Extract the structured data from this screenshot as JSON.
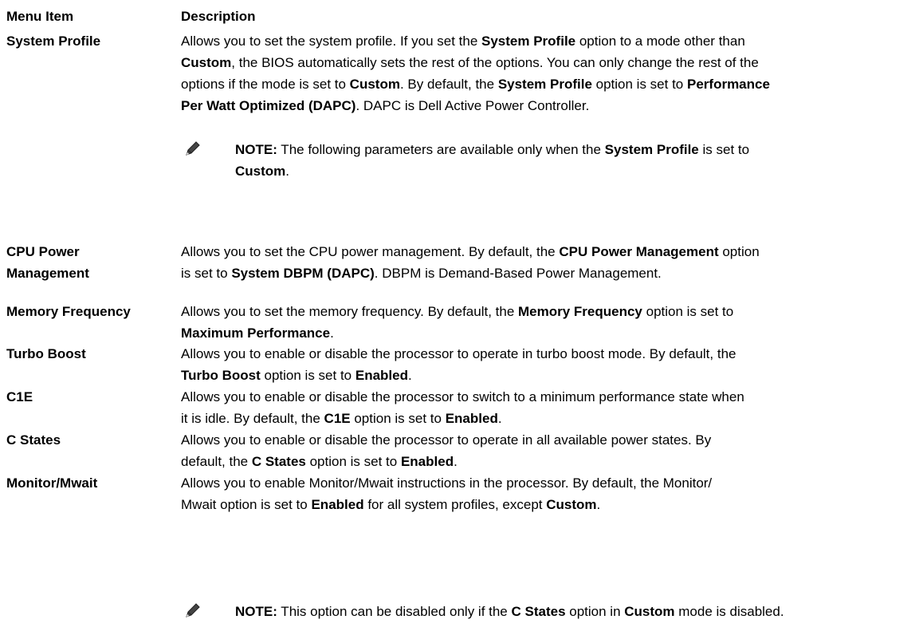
{
  "header": {
    "col1": "Menu Item",
    "col2": "Description"
  },
  "rows": [
    {
      "item": "System Profile",
      "desc": [
        [
          [
            "Allows you to set the system profile. If you set the ",
            false
          ],
          [
            "System Profile",
            true
          ],
          [
            " option to a mode other than",
            false
          ]
        ],
        [
          [
            "Custom",
            true
          ],
          [
            ", the BIOS automatically sets the rest of the options. You can only change the rest of the",
            false
          ]
        ],
        [
          [
            "options if the mode is set to ",
            false
          ],
          [
            "Custom",
            true
          ],
          [
            ". By default, the ",
            false
          ],
          [
            "System Profile",
            true
          ],
          [
            " option is set to ",
            false
          ],
          [
            "Performance",
            true
          ]
        ],
        [
          [
            "Per Watt Optimized (DAPC)",
            true
          ],
          [
            ". DAPC is Dell Active Power Controller.",
            false
          ]
        ]
      ],
      "note": [
        [
          [
            "NOTE:",
            true
          ],
          [
            " The following parameters are available only when the ",
            false
          ],
          [
            "System Profile",
            true
          ],
          [
            " is set to",
            false
          ]
        ],
        [
          [
            "Custom",
            true
          ],
          [
            ".",
            false
          ]
        ]
      ]
    },
    {
      "item_lines": [
        "CPU Power",
        "Management"
      ],
      "desc": [
        [
          [
            "Allows you to set the CPU power management. By default, the ",
            false
          ],
          [
            "CPU Power Management",
            true
          ],
          [
            " option",
            false
          ]
        ],
        [
          [
            "is set to ",
            false
          ],
          [
            "System DBPM (DAPC)",
            true
          ],
          [
            ". DBPM is Demand-Based Power Management.",
            false
          ]
        ]
      ]
    },
    {
      "item": "Memory Frequency",
      "desc": [
        [
          [
            "Allows you to set the memory frequency. By default, the ",
            false
          ],
          [
            "Memory Frequency",
            true
          ],
          [
            " option is set to",
            false
          ]
        ],
        [
          [
            "Maximum Performance",
            true
          ],
          [
            ".",
            false
          ]
        ]
      ]
    },
    {
      "item": "Turbo Boost",
      "desc": [
        [
          [
            "Allows you to enable or disable the processor to operate in turbo boost mode. By default, the",
            false
          ]
        ],
        [
          [
            "Turbo Boost",
            true
          ],
          [
            " option is set to ",
            false
          ],
          [
            "Enabled",
            true
          ],
          [
            ".",
            false
          ]
        ]
      ]
    },
    {
      "item": "C1E",
      "desc": [
        [
          [
            "Allows you to enable or disable the processor to switch to a minimum performance state when",
            false
          ]
        ],
        [
          [
            "it is idle. By default, the ",
            false
          ],
          [
            "C1E",
            true
          ],
          [
            " option is set to ",
            false
          ],
          [
            "Enabled",
            true
          ],
          [
            ".",
            false
          ]
        ]
      ]
    },
    {
      "item": "C States",
      "desc": [
        [
          [
            "Allows you to enable or disable the processor to operate in all available power states. By",
            false
          ]
        ],
        [
          [
            "default, the ",
            false
          ],
          [
            "C States",
            true
          ],
          [
            " option is set to ",
            false
          ],
          [
            "Enabled",
            true
          ],
          [
            ".",
            false
          ]
        ]
      ]
    },
    {
      "item": "Monitor/Mwait",
      "desc": [
        [
          [
            "Allows you to enable Monitor/Mwait instructions in the processor. By default, the Monitor/",
            false
          ]
        ],
        [
          [
            "Mwait option is set to ",
            false
          ],
          [
            "Enabled",
            true
          ],
          [
            " for all system profiles, except ",
            false
          ],
          [
            "Custom",
            true
          ],
          [
            ".",
            false
          ]
        ]
      ],
      "note": [
        [
          [
            "NOTE:",
            true
          ],
          [
            " This option can be disabled only if the ",
            false
          ],
          [
            "C States",
            true
          ],
          [
            " option in ",
            false
          ],
          [
            "Custom",
            true
          ],
          [
            " mode is disabled.",
            false
          ]
        ]
      ]
    }
  ]
}
